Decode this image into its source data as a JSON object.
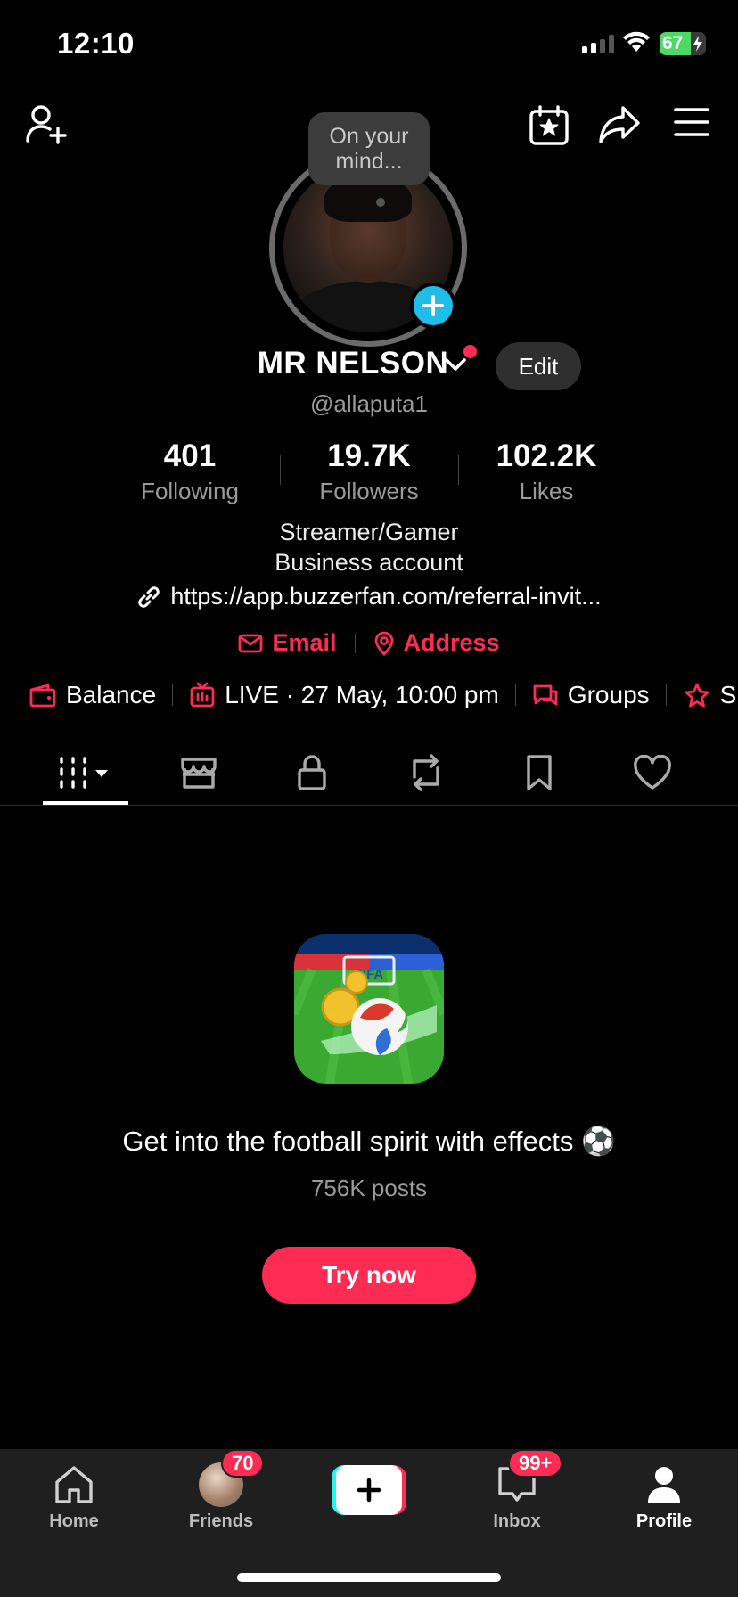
{
  "status_bar": {
    "time": "12:10",
    "battery": "67",
    "battery_level": 0.67
  },
  "bubble": {
    "text_line1": "On your",
    "text_line2": "mind..."
  },
  "profile": {
    "name": "MR NELSON",
    "handle": "@allaputa1",
    "edit_label": "Edit",
    "stats": [
      {
        "value": "401",
        "label": "Following"
      },
      {
        "value": "19.7K",
        "label": "Followers"
      },
      {
        "value": "102.2K",
        "label": "Likes"
      }
    ],
    "bio_line1": "Streamer/Gamer",
    "bio_line2": "Business account",
    "link": "https://app.buzzerfan.com/referral-invit...",
    "email_label": "Email",
    "address_label": "Address"
  },
  "chips": [
    {
      "label": "Balance",
      "icon": "wallet-icon"
    },
    {
      "label": "LIVE · 27 May, 10:00 pm",
      "icon": "live-tv-icon"
    },
    {
      "label": "Groups",
      "icon": "chat-bubbles-icon"
    },
    {
      "label": "Su",
      "icon": "subscription-icon"
    }
  ],
  "tabs": [
    "grid-icon",
    "shop-icon",
    "lock-icon",
    "repost-icon",
    "bookmark-icon",
    "heart-icon"
  ],
  "promo": {
    "title": "Get into the football spirit with effects ⚽",
    "posts": "756K posts",
    "button": "Try now",
    "icon_label": "FIFA"
  },
  "nav": {
    "home": "Home",
    "friends": "Friends",
    "friends_badge": "70",
    "inbox": "Inbox",
    "inbox_badge": "99+",
    "profile": "Profile"
  },
  "colors": {
    "accent": "#fe2c55",
    "cyan": "#25f4ee",
    "add_blue": "#20bde9",
    "background": "#000000"
  }
}
